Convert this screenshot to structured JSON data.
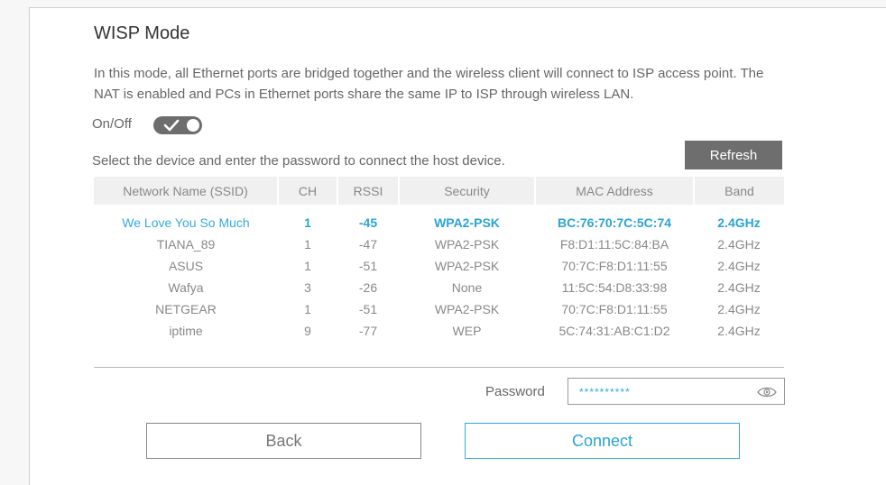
{
  "colors": {
    "accent": "#2aa4d6",
    "toggle_bg": "#6d6d6d",
    "refresh_bg": "#6e6e6e",
    "header_bg": "#f0f0f0"
  },
  "page": {
    "title": "WISP Mode",
    "description": "In this mode, all Ethernet ports are bridged together and the wireless client will connect to ISP access point. The NAT is enabled and PCs in Ethernet ports share the same IP to ISP through wireless LAN."
  },
  "onoff": {
    "label": "On/Off",
    "state": "on",
    "icon": "check-icon"
  },
  "instruction": "Select the device and enter the password to connect the host device.",
  "refresh_label": "Refresh",
  "table": {
    "headers": [
      "Network Name (SSID)",
      "CH",
      "RSSI",
      "Security",
      "MAC Address",
      "Band"
    ],
    "rows": [
      [
        "We Love You So Much",
        "1",
        "-45",
        "WPA2-PSK",
        "BC:76:70:7C:5C:74",
        "2.4GHz"
      ],
      [
        "TIANA_89",
        "1",
        "-47",
        "WPA2-PSK",
        "F8:D1:11:5C:84:BA",
        "2.4GHz"
      ],
      [
        "ASUS",
        "1",
        "-51",
        "WPA2-PSK",
        "70:7C:F8:D1:11:55",
        "2.4GHz"
      ],
      [
        "Wafya",
        "3",
        "-26",
        "None",
        "11:5C:54:D8:33:98",
        "2.4GHz"
      ],
      [
        "NETGEAR",
        "1",
        "-51",
        "WPA2-PSK",
        "70:7C:F8:D1:11:55",
        "2.4GHz"
      ],
      [
        "iptime",
        "9",
        "-77",
        "WEP",
        "5C:74:31:AB:C1:D2",
        "2.4GHz"
      ]
    ],
    "selected_index": 0
  },
  "password": {
    "label": "Password",
    "value": "**********",
    "icon": "eye-icon"
  },
  "buttons": {
    "back": "Back",
    "connect": "Connect"
  }
}
